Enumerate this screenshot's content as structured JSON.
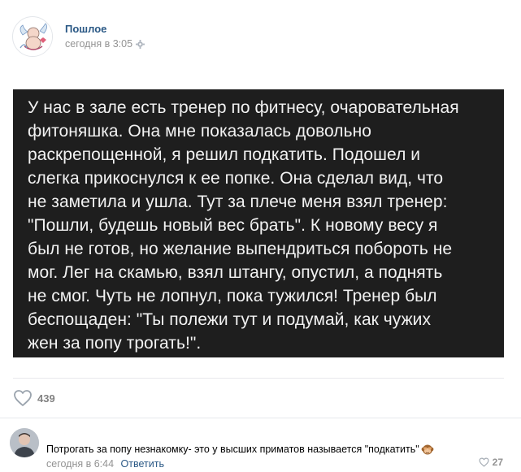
{
  "post": {
    "group_name": "Пошлое",
    "time": "сегодня в 3:05",
    "text": "У нас в зале есть тренер по фитнесу, очаровательная\nфитоняшка. Она мне показалась довольно\nраскрепощенной, я решил подкатить. Подошел и\nслегка прикоснулся к ее попке. Она сделал вид, что\nне заметила и ушла. Тут за плече меня взял тренер:\n\"Пошли, будешь новый вес брать\". К новому весу я\nбыл не готов, но желание выпендриться побороть не\nмог. Лег на скамью, взял штангу, опустил, а поднять\nне смог. Чуть не лопнул, пока тужился! Тренер был\nбеспощаден: \"Ты полежи тут и подумай, как чужих\nжен за попу трогать!\".",
    "likes": "439"
  },
  "comment": {
    "text": "Потрогать за попу незнакомку- это у высших приматов называется \"подкатить\"",
    "time": "сегодня в 6:44",
    "reply_label": "Ответить",
    "likes": "27"
  },
  "icons": {
    "settings": "gear-icon",
    "like": "heart-outline-icon",
    "emoji": "monkey-emoji-icon"
  },
  "colors": {
    "link": "#2a5885",
    "muted": "#939393",
    "post_bg": "#1e1e1e"
  }
}
